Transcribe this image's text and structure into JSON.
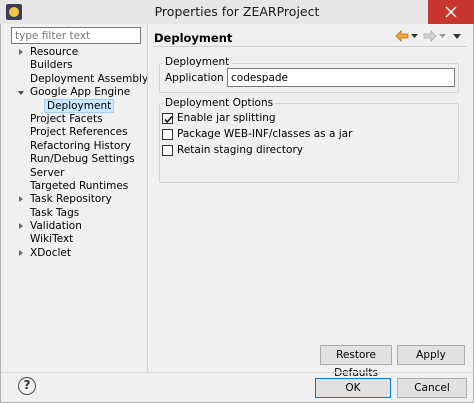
{
  "window": {
    "title": "Properties for ZEARProject",
    "close_glyph": "✕"
  },
  "sidebar": {
    "filter_placeholder": "type filter text",
    "items": [
      {
        "label": "Resource",
        "arrow": "collapsed",
        "level": 1
      },
      {
        "label": "Builders",
        "arrow": "none",
        "level": 1
      },
      {
        "label": "Deployment Assembly",
        "arrow": "none",
        "level": 1
      },
      {
        "label": "Google App Engine",
        "arrow": "expanded",
        "level": 1
      },
      {
        "label": "Deployment",
        "arrow": "none",
        "level": 2,
        "selected": true
      },
      {
        "label": "Project Facets",
        "arrow": "none",
        "level": 1
      },
      {
        "label": "Project References",
        "arrow": "none",
        "level": 1
      },
      {
        "label": "Refactoring History",
        "arrow": "none",
        "level": 1
      },
      {
        "label": "Run/Debug Settings",
        "arrow": "none",
        "level": 1
      },
      {
        "label": "Server",
        "arrow": "none",
        "level": 1
      },
      {
        "label": "Targeted Runtimes",
        "arrow": "none",
        "level": 1
      },
      {
        "label": "Task Repository",
        "arrow": "collapsed",
        "level": 1
      },
      {
        "label": "Task Tags",
        "arrow": "none",
        "level": 1
      },
      {
        "label": "Validation",
        "arrow": "collapsed",
        "level": 1
      },
      {
        "label": "WikiText",
        "arrow": "none",
        "level": 1
      },
      {
        "label": "XDoclet",
        "arrow": "collapsed",
        "level": 1
      }
    ]
  },
  "page": {
    "title": "Deployment",
    "nav_back_icon": "back-arrow-icon",
    "nav_forward_icon": "forward-arrow-icon",
    "deployment_group": {
      "label": "Deployment",
      "app_id_label": "Application ID:",
      "app_id_value": "codespade"
    },
    "options_group": {
      "label": "Deployment Options",
      "options": [
        {
          "label": "Enable jar splitting",
          "checked": true
        },
        {
          "label": "Package WEB-INF/classes as a jar",
          "checked": false
        },
        {
          "label": "Retain staging directory",
          "checked": false
        }
      ]
    },
    "restore_defaults_label": "Restore Defaults",
    "apply_label": "Apply"
  },
  "footer": {
    "help_glyph": "?",
    "ok_label": "OK",
    "cancel_label": "Cancel"
  },
  "colors": {
    "selection_bg": "#cce8ff",
    "close_button": "#c7372f",
    "back_arrow": "#f0a53c"
  }
}
